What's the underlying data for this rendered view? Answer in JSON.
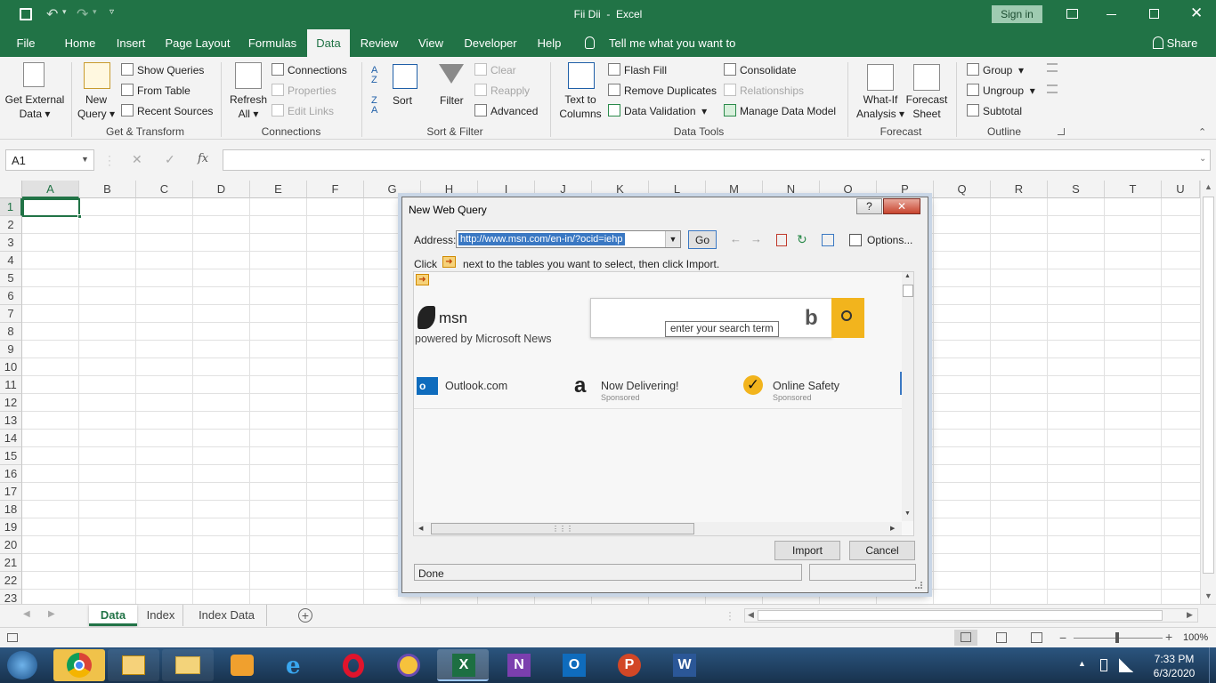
{
  "window": {
    "title": "Fii Dii  -  Excel",
    "sign_in": "Sign in",
    "share": "Share"
  },
  "tabs": [
    "File",
    "Home",
    "Insert",
    "Page Layout",
    "Formulas",
    "Data",
    "Review",
    "View",
    "Developer",
    "Help"
  ],
  "tell_me": "Tell me what you want to do",
  "ribbon": {
    "get_external": [
      "Get External",
      "Data"
    ],
    "new_query": [
      "New",
      "Query"
    ],
    "show_queries": "Show Queries",
    "from_table": "From Table",
    "recent_sources": "Recent Sources",
    "refresh_all": [
      "Refresh",
      "All"
    ],
    "connections": "Connections",
    "properties": "Properties",
    "edit_links": "Edit Links",
    "sort": "Sort",
    "filter": "Filter",
    "clear": "Clear",
    "reapply": "Reapply",
    "advanced": "Advanced",
    "text_to_columns": [
      "Text to",
      "Columns"
    ],
    "flash_fill": "Flash Fill",
    "remove_duplicates": "Remove Duplicates",
    "data_validation": "Data Validation",
    "consolidate": "Consolidate",
    "relationships": "Relationships",
    "manage_data_model": "Manage Data Model",
    "what_if": [
      "What-If",
      "Analysis"
    ],
    "forecast_sheet": [
      "Forecast",
      "Sheet"
    ],
    "group": "Group",
    "ungroup": "Ungroup",
    "subtotal": "Subtotal",
    "groups": [
      "Get & Transform",
      "Connections",
      "Sort & Filter",
      "Data Tools",
      "Forecast",
      "Outline"
    ]
  },
  "formula_bar": {
    "name_box": "A1",
    "fx": "fx"
  },
  "columns": [
    "A",
    "B",
    "C",
    "D",
    "E",
    "F",
    "G",
    "H",
    "I",
    "J",
    "K",
    "L",
    "M",
    "N",
    "O",
    "P",
    "Q",
    "R",
    "S",
    "T",
    "U"
  ],
  "rows": [
    "1",
    "2",
    "3",
    "4",
    "5",
    "6",
    "7",
    "8",
    "9",
    "10",
    "11",
    "12",
    "13",
    "14",
    "15",
    "16",
    "17",
    "18",
    "19",
    "20",
    "21",
    "22",
    "23"
  ],
  "sheets": [
    "Data",
    "Index",
    "Index Data"
  ],
  "status": {
    "zoom": "100%"
  },
  "dialog": {
    "title": "New Web Query",
    "help": "?",
    "address_label": "Address:",
    "address_value": "http://www.msn.com/en-in/?ocid=iehp",
    "go": "Go",
    "options": "Options...",
    "instruction_click": "Click",
    "instruction_rest": "next to the tables you want to select, then click Import.",
    "msn_logo": "msn",
    "powered_by": "powered by Microsoft News",
    "search_tooltip": "enter your search term",
    "links": [
      {
        "label": "Outlook.com",
        "sub": ""
      },
      {
        "label": "Now Delivering!",
        "sub": "Sponsored"
      },
      {
        "label": "Online Safety",
        "sub": "Sponsored"
      }
    ],
    "import": "Import",
    "cancel": "Cancel",
    "status": "Done"
  },
  "taskbar": {
    "time": "7:33 PM",
    "date": "6/3/2020"
  }
}
